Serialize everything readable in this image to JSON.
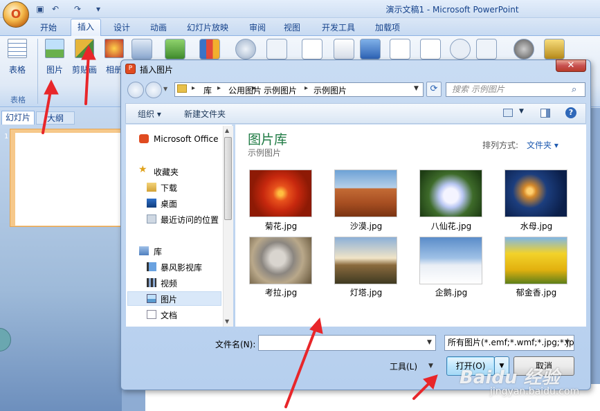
{
  "app": {
    "title": "演示文稿1 - Microsoft PowerPoint",
    "office_button": "O"
  },
  "ribbon": {
    "tabs": [
      "开始",
      "插入",
      "设计",
      "动画",
      "幻灯片放映",
      "审阅",
      "视图",
      "开发工具",
      "加载项"
    ],
    "active_tab": "插入",
    "buttons": {
      "table": "表格",
      "picture": "图片",
      "clipart": "剪贴画",
      "album": "相册"
    },
    "group_table": "表格"
  },
  "slides_pane": {
    "tab_slides": "幻灯片",
    "tab_outline": "大纲",
    "thumb_number": "1"
  },
  "dialog": {
    "title": "插入图片",
    "close": "✕",
    "breadcrumb": [
      "库",
      "公用图片",
      "示例图片"
    ],
    "search_placeholder": "搜索 示例图片",
    "toolbar": {
      "organize": "组织 ▾",
      "new_folder": "新建文件夹"
    },
    "nav": {
      "microsoft_office": "Microsoft Office",
      "favorites": "收藏夹",
      "downloads": "下载",
      "desktop": "桌面",
      "recent": "最近访问的位置",
      "libraries": "库",
      "storm": "暴风影视库",
      "videos": "视频",
      "pictures": "图片",
      "documents": "文档"
    },
    "library_title": "图片库",
    "library_subtitle": "示例图片",
    "sort_label": "排列方式:",
    "sort_value": "文件夹 ▾",
    "files": [
      {
        "name": "菊花.jpg"
      },
      {
        "name": "沙漠.jpg"
      },
      {
        "name": "八仙花.jpg"
      },
      {
        "name": "水母.jpg"
      },
      {
        "name": "考拉.jpg"
      },
      {
        "name": "灯塔.jpg"
      },
      {
        "name": "企鹅.jpg"
      },
      {
        "name": "郁金香.jpg"
      }
    ],
    "filename_label": "文件名(N):",
    "filename_value": "",
    "filetype": "所有图片(*.emf;*.wmf;*.jpg;*.jp",
    "tools": "工具(L)",
    "open": "打开(O)",
    "cancel": "取消"
  },
  "watermark": {
    "brand": "Baidu 经验",
    "url": "jingyan.baidu.com"
  }
}
